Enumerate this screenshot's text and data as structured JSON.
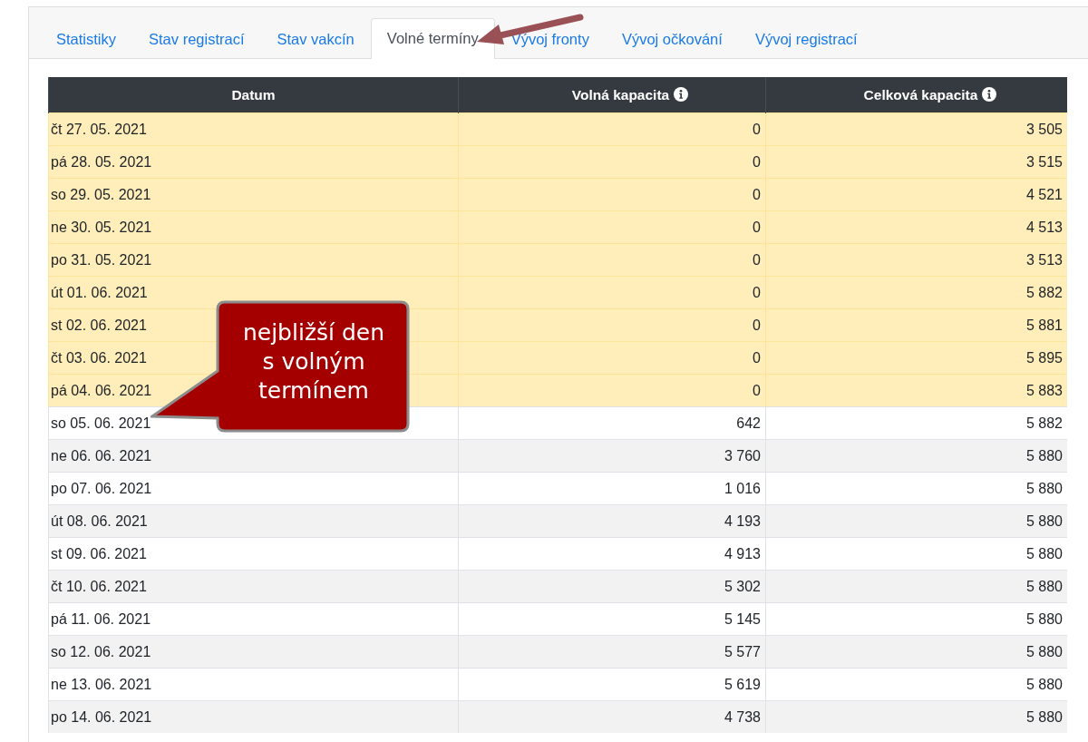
{
  "tabs": [
    {
      "label": "Statistiky",
      "selected": false
    },
    {
      "label": "Stav registrací",
      "selected": false
    },
    {
      "label": "Stav vakcín",
      "selected": false
    },
    {
      "label": "Volné termíny",
      "selected": true
    },
    {
      "label": "Vývoj fronty",
      "selected": false
    },
    {
      "label": "Vývoj očkování",
      "selected": false
    },
    {
      "label": "Vývoj registrací",
      "selected": false
    }
  ],
  "table": {
    "columns": [
      {
        "label": "Datum",
        "info": false
      },
      {
        "label": "Volná kapacita",
        "info": true
      },
      {
        "label": "Celková kapacita",
        "info": true
      }
    ],
    "rows": [
      {
        "date": "čt 27. 05. 2021",
        "free": "0",
        "total": "3 505",
        "highlighted": true
      },
      {
        "date": "pá 28. 05. 2021",
        "free": "0",
        "total": "3 515",
        "highlighted": true
      },
      {
        "date": "so 29. 05. 2021",
        "free": "0",
        "total": "4 521",
        "highlighted": true
      },
      {
        "date": "ne 30. 05. 2021",
        "free": "0",
        "total": "4 513",
        "highlighted": true
      },
      {
        "date": "po 31. 05. 2021",
        "free": "0",
        "total": "3 513",
        "highlighted": true
      },
      {
        "date": "út 01. 06. 2021",
        "free": "0",
        "total": "5 882",
        "highlighted": true
      },
      {
        "date": "st 02. 06. 2021",
        "free": "0",
        "total": "5 881",
        "highlighted": true
      },
      {
        "date": "čt 03. 06. 2021",
        "free": "0",
        "total": "5 895",
        "highlighted": true
      },
      {
        "date": "pá 04. 06. 2021",
        "free": "0",
        "total": "5 883",
        "highlighted": true
      },
      {
        "date": "so 05. 06. 2021",
        "free": "642",
        "total": "5 882",
        "highlighted": false
      },
      {
        "date": "ne 06. 06. 2021",
        "free": "3 760",
        "total": "5 880",
        "highlighted": false
      },
      {
        "date": "po 07. 06. 2021",
        "free": "1 016",
        "total": "5 880",
        "highlighted": false
      },
      {
        "date": "út 08. 06. 2021",
        "free": "4 193",
        "total": "5 880",
        "highlighted": false
      },
      {
        "date": "st 09. 06. 2021",
        "free": "4 913",
        "total": "5 880",
        "highlighted": false
      },
      {
        "date": "čt 10. 06. 2021",
        "free": "5 302",
        "total": "5 880",
        "highlighted": false
      },
      {
        "date": "pá 11. 06. 2021",
        "free": "5 145",
        "total": "5 880",
        "highlighted": false
      },
      {
        "date": "so 12. 06. 2021",
        "free": "5 577",
        "total": "5 880",
        "highlighted": false
      },
      {
        "date": "ne 13. 06. 2021",
        "free": "5 619",
        "total": "5 880",
        "highlighted": false
      },
      {
        "date": "po 14. 06. 2021",
        "free": "4 738",
        "total": "5 880",
        "highlighted": false
      }
    ]
  },
  "callout": {
    "text": "nejbližší den s volným termínem"
  }
}
